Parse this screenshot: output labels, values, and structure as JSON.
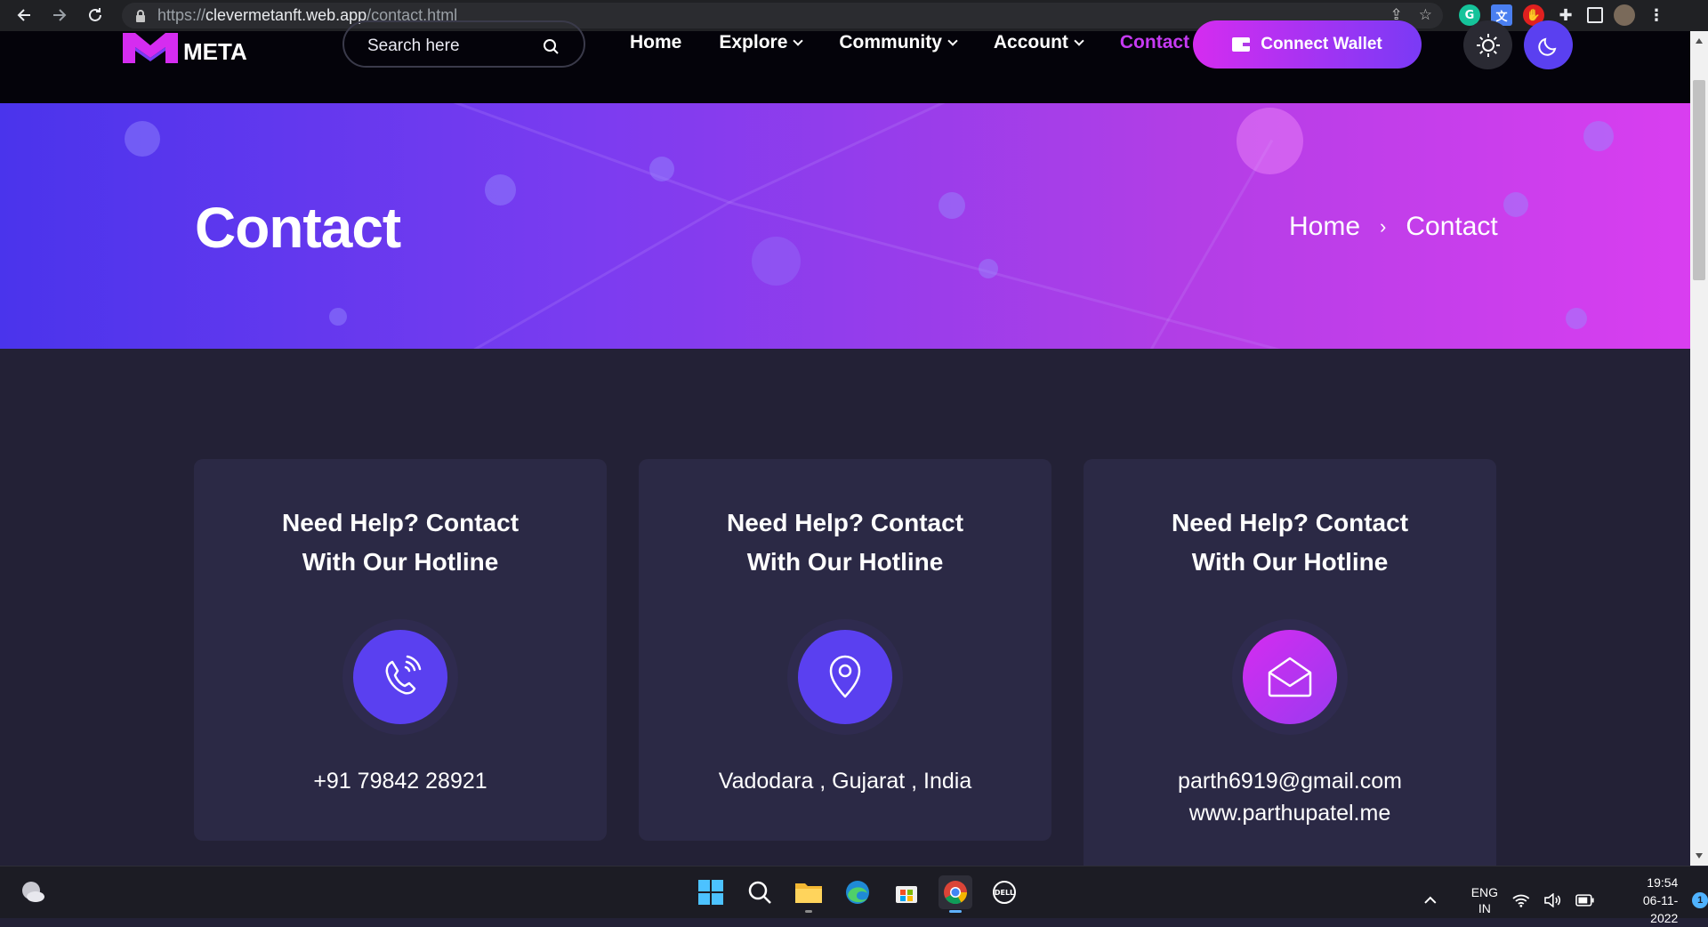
{
  "browser": {
    "url_scheme": "https://",
    "url_host": "clevermetanft.web.app",
    "url_path": "/contact.html"
  },
  "header": {
    "logo_text": "META",
    "search_placeholder": "Search here",
    "menu": [
      {
        "label": "Home"
      },
      {
        "label": "Explore"
      },
      {
        "label": "Community"
      },
      {
        "label": "Account"
      },
      {
        "label": "Contact"
      }
    ],
    "wallet_label": "Connect Wallet"
  },
  "banner": {
    "title": "Contact",
    "breadcrumb_home": "Home",
    "breadcrumb_sep": "›",
    "breadcrumb_current": "Contact"
  },
  "cards": [
    {
      "title_line1": "Need Help? Contact",
      "title_line2": "With Our Hotline",
      "icon": "phone-icon",
      "line1": "+91 79842 28921",
      "line2": ""
    },
    {
      "title_line1": "Need Help? Contact",
      "title_line2": "With Our Hotline",
      "icon": "location-pin-icon",
      "line1": "Vadodara , Gujarat , India",
      "line2": ""
    },
    {
      "title_line1": "Need Help? Contact",
      "title_line2": "With Our Hotline",
      "icon": "envelope-open-icon",
      "line1": "parth6919@gmail.com",
      "line2": "www.parthupatel.me"
    }
  ],
  "colors": {
    "accent": "#c63af2",
    "primary": "#5a40f0",
    "background": "#232136",
    "card": "#2b2945"
  },
  "taskbar": {
    "lang_line1": "ENG",
    "lang_line2": "IN",
    "time": "19:54",
    "date": "06-11-2022",
    "notification_count": "1"
  }
}
